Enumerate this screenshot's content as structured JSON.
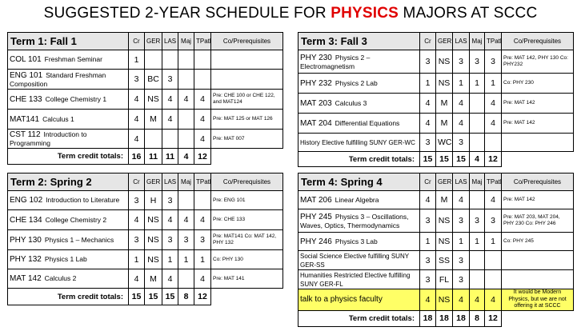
{
  "title": {
    "prefix": "SUGGESTED 2-YEAR SCHEDULE FOR ",
    "highlight": "PHYSICS",
    "suffix": " MAJORS AT SCCC"
  },
  "columns": [
    "Cr",
    "GER",
    "LAS",
    "Maj",
    "TPath",
    "Co/Prerequisites"
  ],
  "total_label": "Term credit totals:",
  "colors": {
    "highlight_red": "#e00000",
    "header_gray": "#e6e6e6",
    "note_yellow": "#ffff66"
  },
  "terms": {
    "t1": {
      "name": "Term 1: Fall 1",
      "courses": [
        {
          "code": "COL 101",
          "title": "Freshman Seminar",
          "cr": "1",
          "ger": "",
          "las": "",
          "maj": "",
          "tpath": "",
          "pre": ""
        },
        {
          "code": "ENG 101",
          "title": "Standard Freshman Composition",
          "cr": "3",
          "ger": "BC",
          "las": "3",
          "maj": "",
          "tpath": "",
          "pre": ""
        },
        {
          "code": "CHE 133",
          "title": "College Chemistry 1",
          "cr": "4",
          "ger": "NS",
          "las": "4",
          "maj": "4",
          "tpath": "4",
          "pre": "Pre: CHE 100 or CHE 122, and MAT124"
        },
        {
          "code": "MAT141",
          "title": "Calculus 1",
          "cr": "4",
          "ger": "M",
          "las": "4",
          "maj": "",
          "tpath": "4",
          "pre": "Pre: MAT 125 or MAT 126"
        },
        {
          "code": "CST 112",
          "title": "Introduction to Programming",
          "cr": "4",
          "ger": "",
          "las": "",
          "maj": "",
          "tpath": "4",
          "pre": "Pre: MAT 007"
        }
      ],
      "totals": {
        "cr": "16",
        "ger": "11",
        "las": "11",
        "maj": "4",
        "tpath": "12"
      }
    },
    "t2": {
      "name": "Term 2: Spring 2",
      "courses": [
        {
          "code": "ENG 102",
          "title": "Introduction to Literature",
          "cr": "3",
          "ger": "H",
          "las": "3",
          "maj": "",
          "tpath": "",
          "pre": "Pre: ENG 101"
        },
        {
          "code": "CHE 134",
          "title": "College Chemistry 2",
          "cr": "4",
          "ger": "NS",
          "las": "4",
          "maj": "4",
          "tpath": "4",
          "pre": "Pre: CHE 133"
        },
        {
          "code": "PHY 130",
          "title": "Physics 1 – Mechanics",
          "cr": "3",
          "ger": "NS",
          "las": "3",
          "maj": "3",
          "tpath": "3",
          "pre": "Pre: MAT141 Co: MAT 142, PHY 132"
        },
        {
          "code": "PHY 132",
          "title": "Physics 1 Lab",
          "cr": "1",
          "ger": "NS",
          "las": "1",
          "maj": "1",
          "tpath": "1",
          "pre": "Co: PHY 130"
        },
        {
          "code": "MAT 142",
          "title": "Calculus 2",
          "cr": "4",
          "ger": "M",
          "las": "4",
          "maj": "",
          "tpath": "4",
          "pre": "Pre: MAT 141"
        }
      ],
      "totals": {
        "cr": "15",
        "ger": "15",
        "las": "15",
        "maj": "8",
        "tpath": "12"
      }
    },
    "t3": {
      "name": "Term 3: Fall 3",
      "courses": [
        {
          "code": "PHY 230",
          "title": "Physics 2 – Electromagnetism",
          "cr": "3",
          "ger": "NS",
          "las": "3",
          "maj": "3",
          "tpath": "3",
          "pre": "Pre: MAT 142, PHY 130 Co: PHY232"
        },
        {
          "code": "PHY 232",
          "title": "Physics 2 Lab",
          "cr": "1",
          "ger": "NS",
          "las": "1",
          "maj": "1",
          "tpath": "1",
          "pre": "Co: PHY 230"
        },
        {
          "code": "MAT 203",
          "title": "Calculus 3",
          "cr": "4",
          "ger": "M",
          "las": "4",
          "maj": "",
          "tpath": "4",
          "pre": "Pre: MAT 142"
        },
        {
          "code": "MAT 204",
          "title": "Differential Equations",
          "cr": "4",
          "ger": "M",
          "las": "4",
          "maj": "",
          "tpath": "4",
          "pre": "Pre: MAT 142"
        },
        {
          "code": "",
          "title": "History Elective fulfilling SUNY GER-WC",
          "cr": "3",
          "ger": "WC",
          "las": "3",
          "maj": "",
          "tpath": "",
          "pre": ""
        }
      ],
      "totals": {
        "cr": "15",
        "ger": "15",
        "las": "15",
        "maj": "4",
        "tpath": "12"
      }
    },
    "t4": {
      "name": "Term 4: Spring 4",
      "courses": [
        {
          "code": "MAT 206",
          "title": "Linear Algebra",
          "cr": "4",
          "ger": "M",
          "las": "4",
          "maj": "",
          "tpath": "4",
          "pre": "Pre: MAT 142"
        },
        {
          "code": "PHY 245",
          "title": "Physics 3 – Oscillations, Waves, Optics, Thermodynamics",
          "cr": "3",
          "ger": "NS",
          "las": "3",
          "maj": "3",
          "tpath": "3",
          "pre": "Pre: MAT 203, MAT 204, PHY 230 Co: PHY 246"
        },
        {
          "code": "PHY 246",
          "title": "Physics 3 Lab",
          "cr": "1",
          "ger": "NS",
          "las": "1",
          "maj": "1",
          "tpath": "1",
          "pre": "Co: PHY 245"
        },
        {
          "code": "",
          "title": "Social Science Elective fulfilling SUNY GER-SS",
          "cr": "3",
          "ger": "SS",
          "las": "3",
          "maj": "",
          "tpath": "",
          "pre": ""
        },
        {
          "code": "",
          "title": "Humanities Restricted Elective fulfilling SUNY GER-FL",
          "cr": "3",
          "ger": "FL",
          "las": "3",
          "maj": "",
          "tpath": "",
          "pre": ""
        },
        {
          "code": "",
          "title": "talk to a physics faculty",
          "cr": "4",
          "ger": "NS",
          "las": "4",
          "maj": "4",
          "tpath": "4",
          "pre": "It would be Modern Physics, but we are not offering it at SCCC"
        }
      ],
      "totals": {
        "cr": "18",
        "ger": "18",
        "las": "18",
        "maj": "8",
        "tpath": "12"
      }
    }
  }
}
